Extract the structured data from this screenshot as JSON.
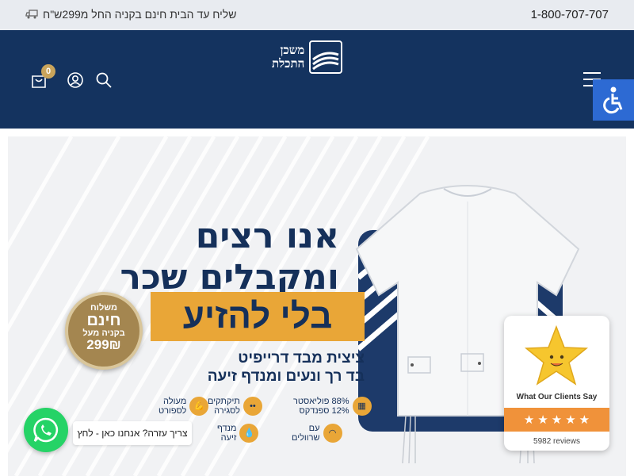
{
  "topbar": {
    "phone": "1-800-707-707",
    "shipping": "שליח עד הבית חינם בקניה החל מ299ש\"ח"
  },
  "header": {
    "logo_line1": "משכן",
    "logo_line2": "התכלת",
    "cart_count": "0"
  },
  "hero": {
    "headline_line1": "אנו רצים",
    "headline_line2": "ומקבלים שכר",
    "highlight": "בלי להזיע",
    "sub_line1": "ציצית מבד דרייפיט",
    "sub_line2": "בד רך ונעים ומנדף זיעה",
    "features": [
      {
        "label_l1": "88% פוליאסטר",
        "label_l2": "12% ספנדקס",
        "icon": "fabric-icon"
      },
      {
        "label_l1": "תיקתקים",
        "label_l2": "לסגירה",
        "icon": "snap-icon"
      },
      {
        "label_l1": "מעולה",
        "label_l2": "לספורט",
        "icon": "muscle-icon"
      },
      {
        "label_l1": "עם",
        "label_l2": "שרוולים",
        "icon": "sleeve-icon"
      },
      {
        "label_l1": "מנדף",
        "label_l2": "זיעה",
        "icon": "drop-icon"
      }
    ],
    "seal_line1": "משלוח",
    "seal_line2": "חינם",
    "seal_line3": "בקניה מעל",
    "seal_line4": "299₪"
  },
  "whatsapp": {
    "label": "צריך עזרה? אנחנו כאן - לחץ"
  },
  "reviews_widget": {
    "title": "What Our Clients Say",
    "count": "5982 reviews",
    "rating": 5
  }
}
